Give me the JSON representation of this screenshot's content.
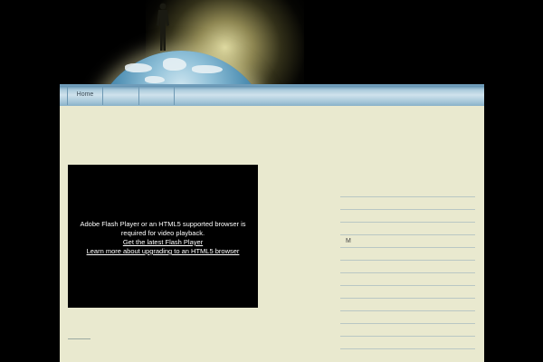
{
  "nav": {
    "items": [
      {
        "label": "Home"
      },
      {
        "label": ""
      },
      {
        "label": ""
      }
    ]
  },
  "video": {
    "message": "Adobe Flash Player or an HTML5 supported browser is required for video playback.",
    "link_flash": "Get the latest Flash Player",
    "link_html5": "Learn more about upgrading to an HTML5 browser"
  },
  "sidebar": {
    "rows": [
      "",
      "",
      "",
      "M",
      "",
      "",
      "",
      "",
      "",
      "",
      "",
      "",
      ""
    ]
  }
}
